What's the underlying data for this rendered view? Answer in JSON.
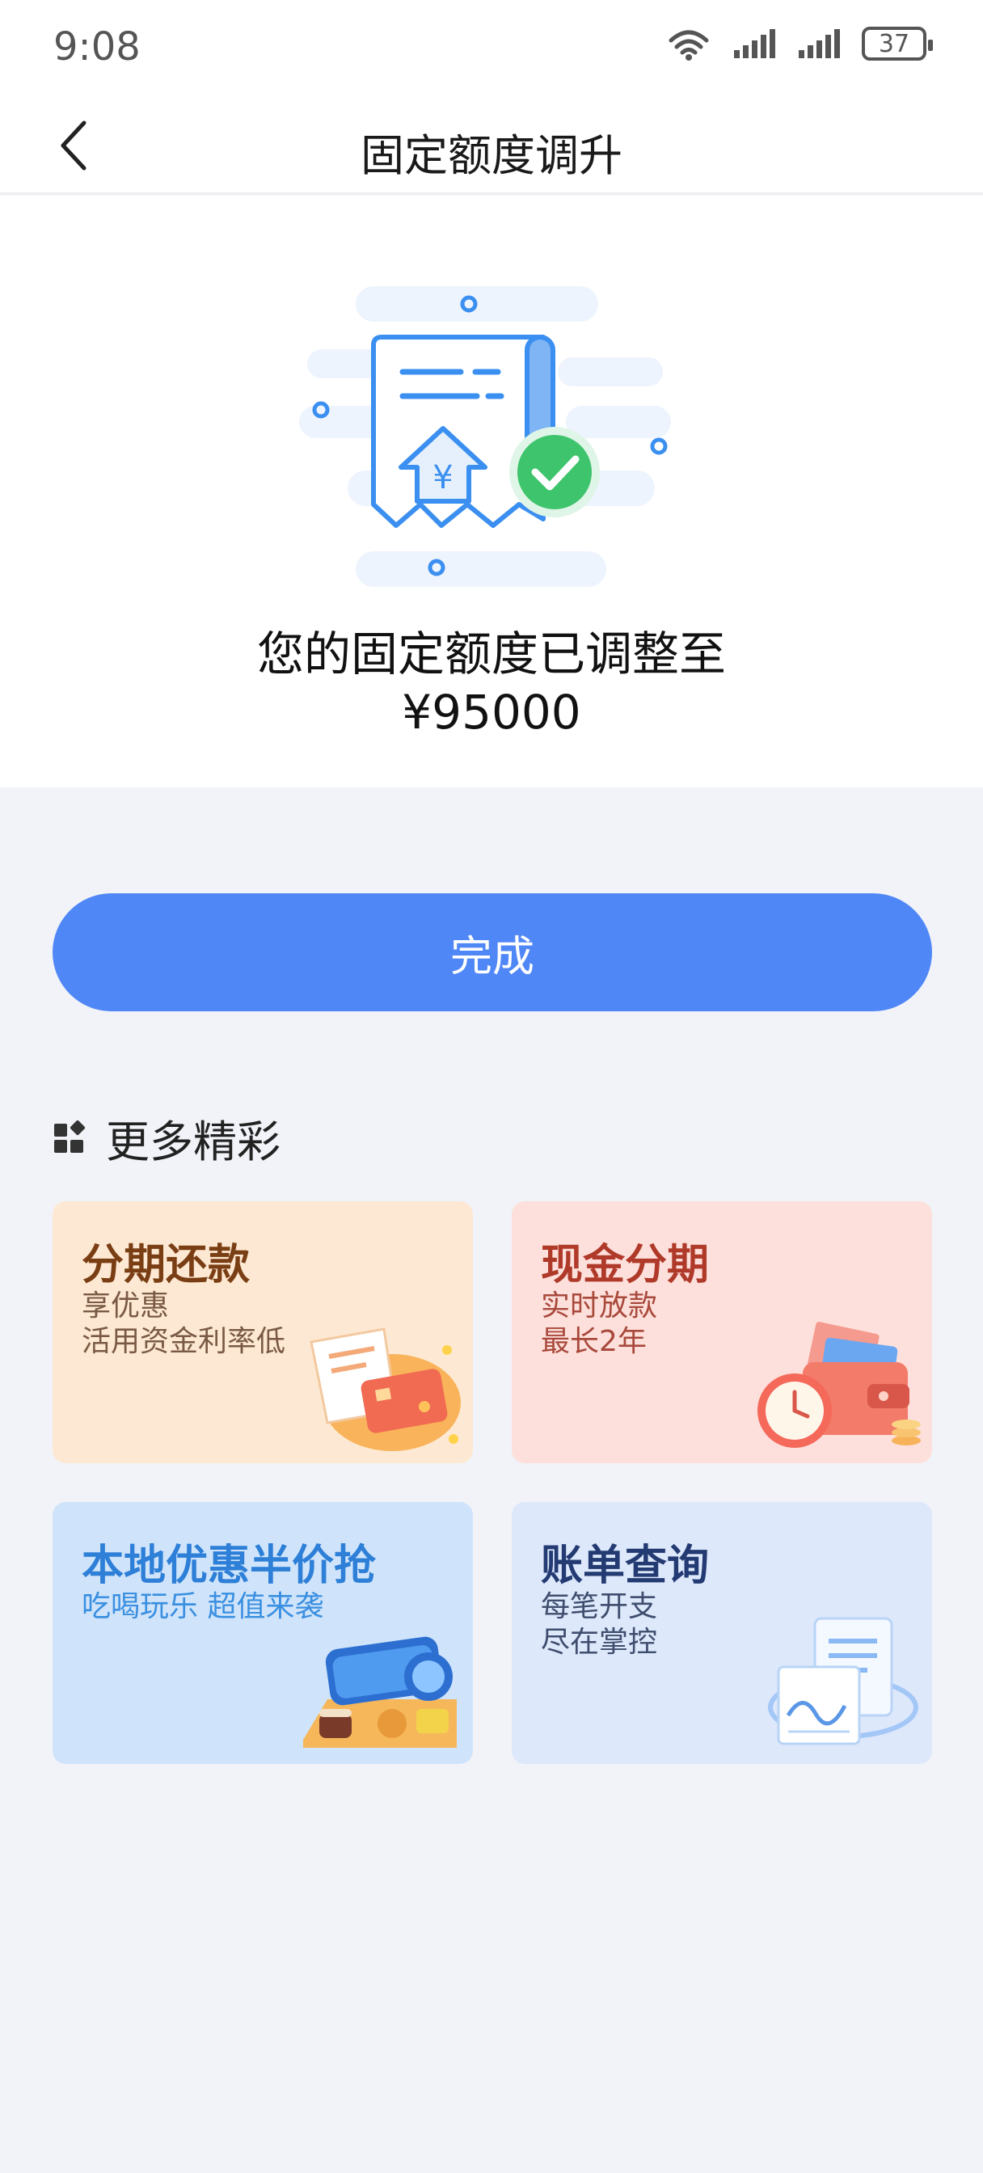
{
  "status_bar": {
    "time": "9:08",
    "battery": "37"
  },
  "header": {
    "title": "固定额度调升"
  },
  "result": {
    "message": "您的固定额度已调整至",
    "amount": "¥95000"
  },
  "actions": {
    "done_label": "完成"
  },
  "more": {
    "title": "更多精彩",
    "cards": [
      {
        "title": "分期还款",
        "line1": "享优惠",
        "line2": "活用资金利率低"
      },
      {
        "title": "现金分期",
        "line1": "实时放款",
        "line2": "最长2年"
      },
      {
        "title": "本地优惠半价抢",
        "line1": "吃喝玩乐 超值来袭",
        "line2": ""
      },
      {
        "title": "账单查询",
        "line1": "每笔开支",
        "line2": "尽在掌控"
      }
    ]
  },
  "colors": {
    "primary": "#5087f7",
    "success": "#3ec46d",
    "background": "#f1f3f8"
  }
}
